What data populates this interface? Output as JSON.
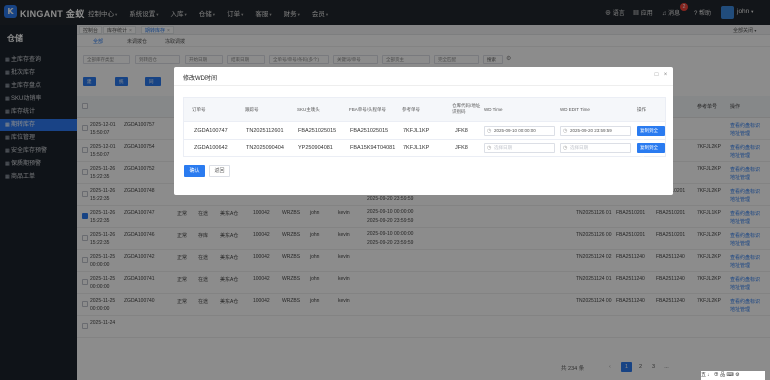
{
  "topbar": {
    "logo_letter": "K",
    "brand": "KINGANT 金蚁",
    "nav": [
      "控制中心",
      "系统设置",
      "入库",
      "仓储",
      "订单",
      "客服",
      "财务",
      "会员"
    ],
    "language": "语言",
    "apps": "应用",
    "messages": "消息",
    "message_count": "2",
    "help": "帮助",
    "user": "john"
  },
  "sidebar": {
    "title": "仓储",
    "items": [
      "主库存查询",
      "批次库存",
      "主库存盘点",
      "SKU动销率",
      "库存统计",
      "期转库存",
      "库位管理",
      "安全库存预警",
      "保质期预警",
      "商品工单"
    ],
    "active_index": 5
  },
  "tabs": {
    "items": [
      "控制台",
      "库存统计",
      "期转库存"
    ],
    "active_index": 2,
    "close_all": "全部关闭"
  },
  "subtabs": [
    "全部",
    "未调拨仓",
    "冻取调拨"
  ],
  "filters": {
    "f1": "全部库存类型",
    "f2": "到转后仓",
    "f3": "开始日期",
    "f4": "结束日期",
    "f5": "全单号/单号/条码(多个)",
    "f6": "关键词/单号",
    "f7": "全部货主",
    "f8": "完全匹配",
    "search": "搜索"
  },
  "action_buttons": [
    "建立条件",
    "统计",
    "同步(库)",
    "导出"
  ],
  "background_table": {
    "right_headers": [
      "参考单号",
      "操作"
    ],
    "rows": [
      {
        "date": "2025-12-01",
        "time": "15:50:07",
        "order": "ZGDA100757",
        "ops": [
          "查看约盘标识",
          "地址管理"
        ]
      },
      {
        "date": "2025-12-01",
        "time": "15:50:07",
        "order": "ZGDA100754",
        "ref": "7KFJL2KP",
        "ops": [
          "查看约盘标识",
          "地址管理"
        ]
      },
      {
        "date": "2025-11-26",
        "time": "15:22:35",
        "order": "ZGDA100752",
        "ref": "7KFJL2KP",
        "ops": [
          "查看约盘标识",
          "地址管理"
        ]
      },
      {
        "date": "2025-11-26",
        "time": "15:22:35",
        "order": "ZGDA100748",
        "status": "正常",
        "type": "存库",
        "wh": "美东A仓",
        "code": "100042",
        "ch": "WRZBS",
        "user": "john",
        "user2": "kevin",
        "t1": "2025-09-10 00:00:00",
        "t2": "2025-09-20 23:59:59",
        "tn": "TN20251126 02",
        "fba": "FBA2510201",
        "fba2": "FBA2510201",
        "ref": "7KFJL2KP",
        "ops": [
          "查看约盘标识",
          "地址管理"
        ]
      },
      {
        "date": "2025-11-26",
        "time": "15:22:35",
        "order": "ZGDA100747",
        "status": "正常",
        "type": "在途",
        "wh": "美东A仓",
        "code": "100042",
        "ch": "WRZBS",
        "user": "john",
        "user2": "kevin",
        "t1": "2025-09-10 00:00:00",
        "t2": "2025-09-20 23:59:59",
        "tn": "TN20251126 01",
        "fba": "FBA2510201",
        "fba2": "FBA2510201",
        "ref": "7KFJL1KP",
        "ops": [
          "查看约盘标识",
          "地址管理"
        ],
        "checked": true
      },
      {
        "date": "2025-11-26",
        "time": "15:22:35",
        "order": "ZGDA100746",
        "status": "正常",
        "type": "存库",
        "wh": "美东A仓",
        "code": "100042",
        "ch": "WRZBS",
        "user": "john",
        "user2": "kevin",
        "t1": "2025-09-10 00:00:00",
        "t2": "2025-09-20 23:59:59",
        "tn": "TN20251126 00",
        "fba": "FBA2510201",
        "fba2": "FBA2510201",
        "ref": "7KFJL2KP",
        "ops": [
          "查看约盘标识",
          "地址管理"
        ]
      },
      {
        "date": "2025-11-25",
        "time": "00:00:00",
        "order": "ZGDA100742",
        "status": "正常",
        "type": "在途",
        "wh": "美东A仓",
        "code": "100042",
        "ch": "WRZBS",
        "user": "john",
        "user2": "kevin",
        "tn": "TN20251124 02",
        "fba": "FBA2511240",
        "fba2": "FBA2511240",
        "ref": "7KFJL2KP",
        "ops": [
          "查看约盘标识",
          "地址管理"
        ]
      },
      {
        "date": "2025-11-25",
        "time": "00:00:00",
        "order": "ZGDA100741",
        "status": "正常",
        "type": "在途",
        "wh": "美东A仓",
        "code": "100042",
        "ch": "WRZBS",
        "user": "john",
        "user2": "kevin",
        "tn": "TN20251124 01",
        "fba": "FBA2511240",
        "fba2": "FBA2511240",
        "ref": "7KFJL2KP",
        "ops": [
          "查看约盘标识",
          "地址管理"
        ]
      },
      {
        "date": "2025-11-25",
        "time": "00:00:00",
        "order": "ZGDA100740",
        "status": "正常",
        "type": "在途",
        "wh": "美东A仓",
        "code": "100042",
        "ch": "WRZBS",
        "user": "john",
        "user2": "kevin",
        "tn": "TN20251124 00",
        "fba": "FBA2511240",
        "fba2": "FBA2511240",
        "ref": "7KFJL2KP",
        "ops": [
          "查看约盘标识",
          "地址管理"
        ]
      },
      {
        "date": "2025-11-24",
        "time": "",
        "order": "",
        "ops": []
      }
    ]
  },
  "pager": {
    "total": "共 234 条",
    "pages": [
      "1",
      "2",
      "3",
      "..."
    ],
    "current": "1"
  },
  "modal": {
    "title": "修改WD时间",
    "headers": [
      "订单号",
      "跟踪号",
      "SKU主唛头",
      "FBA单号/头程单号",
      "参考单号",
      "仓库代码/地址识别码",
      "WD Time",
      "WD EDIT Time",
      "操作"
    ],
    "rows": [
      {
        "order": "ZGDA100747",
        "track": "TN2025112601",
        "sku": "FBA251025015",
        "fba": "FBA251025015",
        "ref": "7KFJL1KP",
        "wh": "JFK8",
        "wd": "2025-09-10 00:00:00",
        "wd_edit": "2025-09-20 23:59:59",
        "action": "复制到全部"
      },
      {
        "order": "ZGDA100642",
        "track": "TN2025090404",
        "sku": "YP250904081",
        "fba": "FBA15K94T04081",
        "ref": "7KFJL1KP",
        "wh": "JFK8",
        "wd": "选择日期",
        "wd_edit": "选择日期",
        "action": "复制到全部"
      }
    ],
    "confirm": "确认",
    "back": "返回"
  },
  "tray": {
    "text": "五 ♩ ⊕ 品 ⌨ ⚙"
  }
}
